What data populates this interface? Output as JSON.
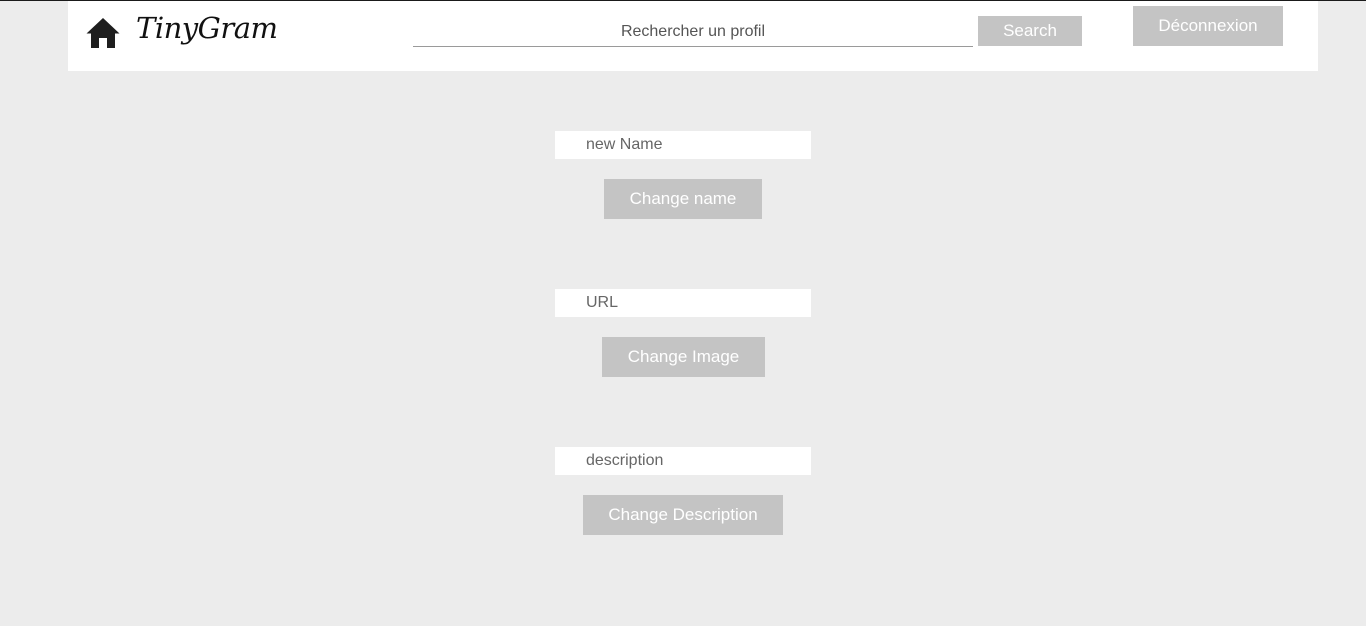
{
  "header": {
    "brand": "TinyGram",
    "home_icon": "home-icon",
    "search_placeholder": "Rechercher un profil",
    "search_value": "",
    "search_label": "Search",
    "logout_label": "Déconnexion"
  },
  "profile_form": {
    "name": {
      "placeholder": "new Name",
      "value": "",
      "button_label": "Change name"
    },
    "image": {
      "placeholder": "URL",
      "value": "",
      "button_label": "Change Image"
    },
    "description": {
      "placeholder": "description",
      "value": "",
      "button_label": "Change Description"
    }
  },
  "colors": {
    "page_background": "#ececec",
    "navbar_background": "#ffffff",
    "button_background": "#c4c4c4",
    "button_text": "#ffffff",
    "input_background": "#ffffff"
  }
}
